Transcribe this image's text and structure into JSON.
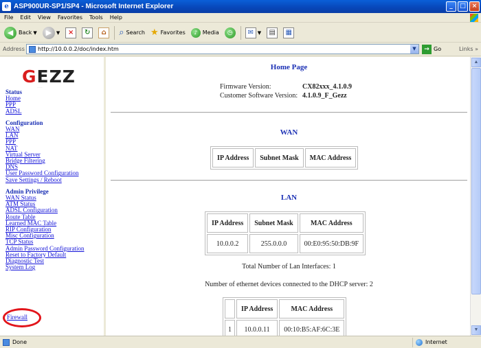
{
  "window": {
    "title": "ASP900UR-SP1/SP4 - Microsoft Internet Explorer"
  },
  "menu": [
    "File",
    "Edit",
    "View",
    "Favorites",
    "Tools",
    "Help"
  ],
  "toolbar": {
    "back": "Back",
    "search": "Search",
    "favorites": "Favorites",
    "media": "Media"
  },
  "address": {
    "label": "Address",
    "url": "http://10.0.0.2/doc/index.htm",
    "go": "Go",
    "links": "Links"
  },
  "sidebar": {
    "logo": "GEZZ",
    "sections": [
      {
        "heading": "Status",
        "links": [
          "Home",
          "PPP",
          "ADSL"
        ]
      },
      {
        "heading": "Configuration",
        "links": [
          "WAN",
          "LAN",
          "PPP",
          "NAT",
          "Virtual Server",
          "Bridge Filtering",
          "DNS",
          "User Password Configuration",
          "Save Settings / Reboot"
        ]
      },
      {
        "heading": "Admin Privilege",
        "links": [
          "WAN Status",
          "ATM Status",
          "ADSL Configuration",
          "Route Table",
          "Learned MAC Table",
          "RIP Configuration",
          "Misc Configuration",
          "TCP Status",
          "Admin Password Configuration",
          "Reset to Factory Default",
          "Diagnostic Test",
          "System Log"
        ]
      }
    ],
    "firewall": "Firewall"
  },
  "main": {
    "title": "Home Page",
    "firmware_label": "Firmware Version:",
    "firmware_value": "CX82xxx_4.1.0.9",
    "customer_label": "Customer Software Version:",
    "customer_value": "4.1.0.9_F_Gezz",
    "wan": {
      "heading": "WAN",
      "headers": [
        "IP Address",
        "Subnet Mask",
        "MAC Address"
      ]
    },
    "lan": {
      "heading": "LAN",
      "headers": [
        "IP Address",
        "Subnet Mask",
        "MAC Address"
      ],
      "row": [
        "10.0.0.2",
        "255.0.0.0",
        "00:E0:95:50:DB:9F"
      ]
    },
    "total_interfaces": "Total Number of Lan Interfaces: 1",
    "dhcp_count": "Number of ethernet devices connected to the DHCP server: 2",
    "dhcp": {
      "headers": [
        "",
        "IP Address",
        "MAC Address"
      ],
      "row": [
        "1",
        "10.0.0.11",
        "00:10:B5:AF:6C:3E"
      ]
    }
  },
  "status": {
    "left": "Done",
    "zone": "Internet"
  },
  "colors": {
    "link": "#1010d8",
    "heading": "#1a2fb4",
    "highlight_ring": "#e2151b",
    "titlebar": "#0a5fd8"
  }
}
